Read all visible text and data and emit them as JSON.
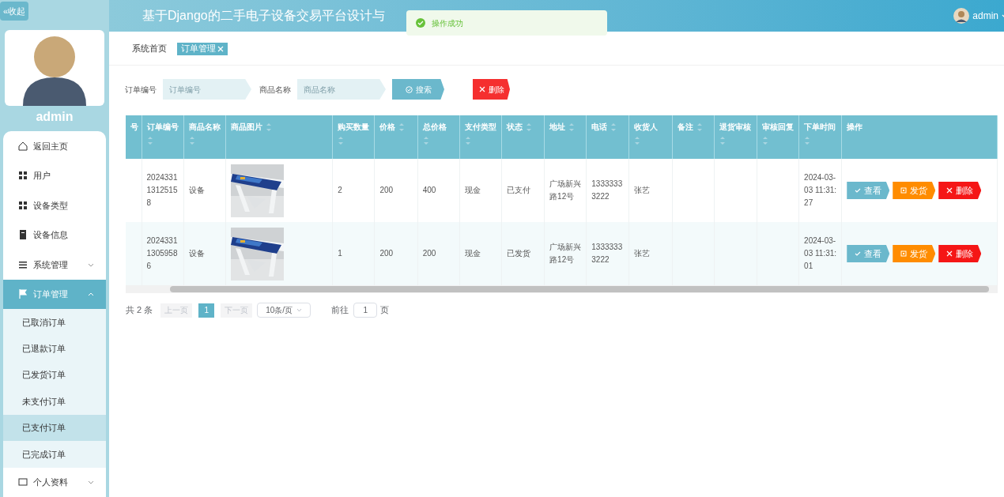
{
  "sidebar": {
    "collapse_label": "«收起",
    "user_name": "admin",
    "items": [
      {
        "label": "返回主页",
        "selected": false
      },
      {
        "label": "用户",
        "selected": false
      },
      {
        "label": "设备类型",
        "selected": false
      },
      {
        "label": "设备信息",
        "selected": false
      },
      {
        "label": "系统管理",
        "selected": false,
        "expanded": false
      },
      {
        "label": "订单管理",
        "selected": true,
        "expanded": true,
        "children": [
          {
            "label": "已取消订单",
            "selected": false
          },
          {
            "label": "已退款订单",
            "selected": false
          },
          {
            "label": "已发货订单",
            "selected": false
          },
          {
            "label": "未支付订单",
            "selected": false
          },
          {
            "label": "已支付订单",
            "selected": true
          },
          {
            "label": "已完成订单",
            "selected": false
          }
        ]
      },
      {
        "label": "个人资料",
        "selected": false,
        "expanded": false
      }
    ]
  },
  "header": {
    "title": "基于Django的二手电子设备交易平台设计与",
    "user": "admin"
  },
  "toast": {
    "message": "操作成功"
  },
  "tabs": [
    {
      "label": "系统首页",
      "selected": false
    },
    {
      "label": "订单管理",
      "selected": true
    }
  ],
  "filters": [
    {
      "label": "订单编号",
      "placeholder": "订单编号"
    },
    {
      "label": "商品名称",
      "placeholder": "商品名称"
    }
  ],
  "search_button": "搜索",
  "delete_button": "删除",
  "table": {
    "columns": [
      {
        "label": "号",
        "sortable": false
      },
      {
        "label": "订单编号",
        "sortable": true
      },
      {
        "label": "商品名称",
        "sortable": true
      },
      {
        "label": "商品图片",
        "sortable": true
      },
      {
        "label": "购买数量",
        "sortable": true
      },
      {
        "label": "价格",
        "sortable": true
      },
      {
        "label": "总价格",
        "sortable": true
      },
      {
        "label": "支付类型",
        "sortable": true
      },
      {
        "label": "状态",
        "sortable": true
      },
      {
        "label": "地址",
        "sortable": true
      },
      {
        "label": "电话",
        "sortable": true
      },
      {
        "label": "收货人",
        "sortable": true
      },
      {
        "label": "备注",
        "sortable": true
      },
      {
        "label": "退货审核",
        "sortable": true
      },
      {
        "label": "审核回复",
        "sortable": true
      },
      {
        "label": "下单时间",
        "sortable": true
      },
      {
        "label": "操作",
        "sortable": false
      }
    ],
    "rows": [
      {
        "order_no": "202433113125158",
        "product": "设备",
        "quantity": "2",
        "price": "200",
        "total": "400",
        "payment": "现金",
        "status": "已支付",
        "address": "广场新兴路12号",
        "phone": "13333333222",
        "receiver": "张艺",
        "order_time": "2024-03-03 11:31:27",
        "actions": [
          "查看",
          "发货",
          "删除"
        ]
      },
      {
        "order_no": "202433113059586",
        "product": "设备",
        "quantity": "1",
        "price": "200",
        "total": "200",
        "payment": "现金",
        "status": "已发货",
        "address": "广场新兴路12号",
        "phone": "13333333222",
        "receiver": "张艺",
        "order_time": "2024-03-03 11:31:01",
        "actions": [
          "查看",
          "发货",
          "删除"
        ]
      }
    ]
  },
  "pagination": {
    "total": "共 2 条",
    "prev": "上一页",
    "pages": [
      {
        "label": "1",
        "selected": true
      }
    ],
    "next": "下一页",
    "page_size": "10条/页",
    "goto_label": "前往",
    "goto_value": "1",
    "goto_suffix": "页"
  }
}
